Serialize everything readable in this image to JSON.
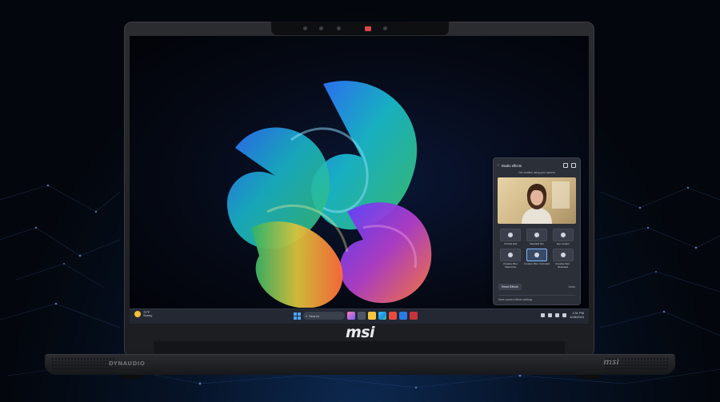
{
  "screen": {
    "taskbar": {
      "weather_temp": "72°F",
      "weather_text": "Sunny",
      "search_placeholder": "Search",
      "clock_time": "1:31 PM",
      "clock_date": "10/8/2024"
    },
    "studio_effects": {
      "title": "Studio effects",
      "subtitle": "Get creative using your camera",
      "effects": [
        {
          "label": "Portrait light",
          "selected": false
        },
        {
          "label": "Standard blur",
          "selected": false
        },
        {
          "label": "Eye contact",
          "selected": false
        },
        {
          "label": "Creative filter: Watercolor",
          "selected": false
        },
        {
          "label": "Creative filter: Animated",
          "selected": true
        },
        {
          "label": "Creative filter: Illustrated",
          "selected": false
        }
      ],
      "reset_label": "Reset Effects",
      "link_label": "Undo",
      "footer": "More camera effects settings"
    }
  },
  "branding": {
    "lid_logo": "msi",
    "speaker_brand": "DYNAUDIO",
    "base_logo": "msi"
  },
  "colors": {
    "accent": "#4aa7ff",
    "panel_bg": "#2b2f38",
    "taskbar_bg": "#232833"
  }
}
